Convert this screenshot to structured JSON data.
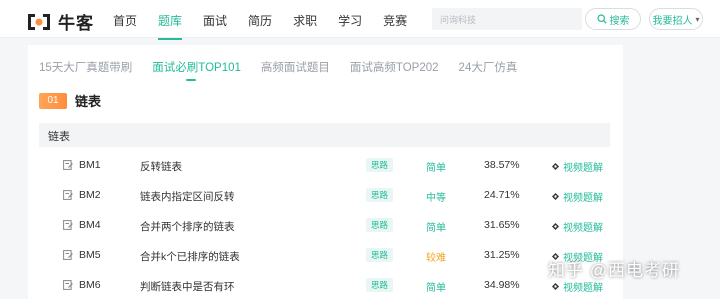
{
  "header": {
    "logo_text": "牛客",
    "nav": [
      {
        "label": "首页",
        "active": false
      },
      {
        "label": "题库",
        "active": true
      },
      {
        "label": "面试",
        "active": false
      },
      {
        "label": "简历",
        "active": false
      },
      {
        "label": "求职",
        "active": false
      },
      {
        "label": "学习",
        "active": false
      },
      {
        "label": "竞赛",
        "active": false
      }
    ],
    "search_placeholder": "问询科技",
    "search_button": "搜索",
    "recruit_button": "我要招人"
  },
  "subtabs": [
    {
      "label": "15天大厂真题带刷",
      "active": false
    },
    {
      "label": "面试必刷TOP101",
      "active": true
    },
    {
      "label": "高频面试题目",
      "active": false
    },
    {
      "label": "面试高频TOP202",
      "active": false
    },
    {
      "label": "24大厂仿真",
      "active": false
    }
  ],
  "section": {
    "number": "01",
    "title": "链表"
  },
  "group": {
    "title": "链表"
  },
  "problems": [
    {
      "code": "BM1",
      "title": "反转链表",
      "tag": "思路",
      "difficulty": "简单",
      "difficulty_color": "#25bb9b",
      "pass_rate": "38.57%",
      "video": "视频题解"
    },
    {
      "code": "BM2",
      "title": "链表内指定区间反转",
      "tag": "思路",
      "difficulty": "中等",
      "difficulty_color": "#25bb9b",
      "pass_rate": "24.71%",
      "video": "视频题解"
    },
    {
      "code": "BM4",
      "title": "合并两个排序的链表",
      "tag": "思路",
      "difficulty": "简单",
      "difficulty_color": "#25bb9b",
      "pass_rate": "31.65%",
      "video": "视频题解"
    },
    {
      "code": "BM5",
      "title": "合并k个已排序的链表",
      "tag": "思路",
      "difficulty": "较难",
      "difficulty_color": "#f5a623",
      "pass_rate": "31.25%",
      "video": "视频题解"
    },
    {
      "code": "BM6",
      "title": "判断链表中是否有环",
      "tag": "思路",
      "difficulty": "简单",
      "difficulty_color": "#25bb9b",
      "pass_rate": "34.98%",
      "video": "视频题解"
    }
  ],
  "watermark": "知乎 @西电考研",
  "colors": {
    "accent": "#25bb9b",
    "badge": "#ff9444"
  }
}
